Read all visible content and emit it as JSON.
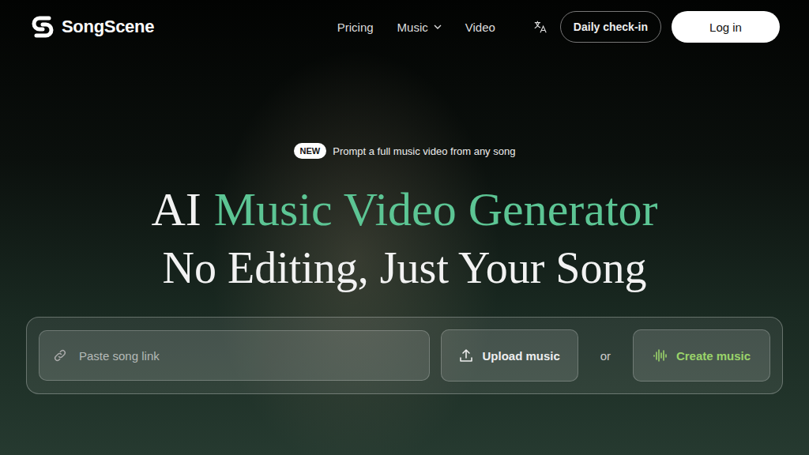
{
  "header": {
    "logo": "SongScene",
    "nav": [
      {
        "label": "Pricing",
        "has_menu": false
      },
      {
        "label": "Music",
        "has_menu": true
      },
      {
        "label": "Video",
        "has_menu": false
      }
    ],
    "daily_check_in": "Daily check-in",
    "login": "Log in"
  },
  "hero": {
    "badge": "NEW",
    "announcement": "Prompt a full music video from any song",
    "title_plain": "AI",
    "title_accent": "Music Video Generator",
    "subtitle": "No Editing, Just Your Song"
  },
  "input_panel": {
    "placeholder": "Paste song link",
    "upload": "Upload music",
    "separator": "or",
    "create": "Create music"
  }
}
